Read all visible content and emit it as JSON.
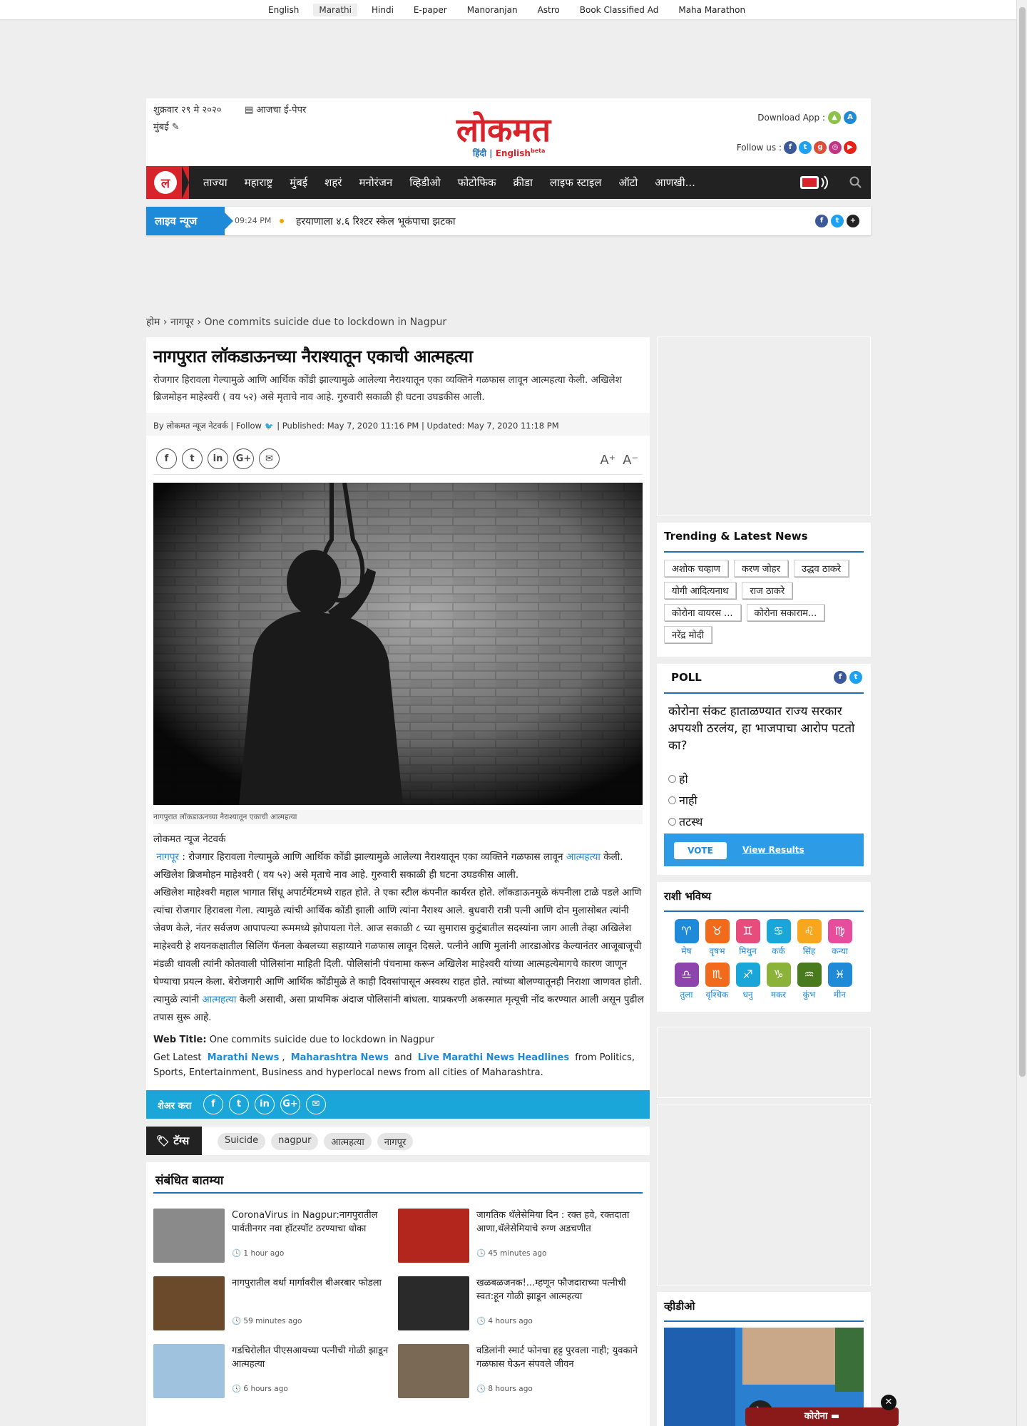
{
  "topbar": {
    "links": [
      {
        "label": "English",
        "active": false
      },
      {
        "label": "Marathi",
        "active": true
      },
      {
        "label": "Hindi",
        "active": false
      },
      {
        "label": "E-paper",
        "active": false
      },
      {
        "label": "Manoranjan",
        "active": false
      },
      {
        "label": "Astro",
        "active": false
      },
      {
        "label": "Book Classified Ad",
        "active": false
      },
      {
        "label": "Maha Marathon",
        "active": false
      }
    ]
  },
  "header": {
    "date": "शुक्रवार २९ मे २०२०",
    "epaper": "आजचा ई-पेपर",
    "city": "मुंबई",
    "logo_text": "लोकमत",
    "logo_hindi": "हिंदी",
    "logo_english": "English",
    "logo_beta": "beta",
    "download_label": "Download App :",
    "follow_label": "Follow us :"
  },
  "nav": {
    "items": [
      "ताज्या",
      "महाराष्ट्र",
      "मुंबई",
      "शहरं",
      "मनोरंजन",
      "व्हिडीओ",
      "फोटोफिक",
      "क्रीडा",
      "लाइफ स्टाइल",
      "ऑटो",
      "आणखी..."
    ]
  },
  "ticker": {
    "label": "लाइव न्यूज",
    "time": "09:24 PM",
    "headline": "हरयाणाला ४.६ रिश्टर स्केल भूकंपाचा झटका"
  },
  "breadcrumb": {
    "home": "होम",
    "section": "नागपूर",
    "current": "One commits suicide due to lockdown in Nagpur"
  },
  "article": {
    "title": "नागपुरात लॉकडाऊनच्या नैराश्यातून एकाची आत्महत्या",
    "summary": "रोजगार हिरावला गेल्यामुळे आणि आर्थिक कोंडी झाल्यामुळे आलेल्या नैराश्यातून एका व्यक्तिने गळफास लावून आत्महत्या केली. अखिलेश ब्रिजमोहन माहेश्वरी ( वय ५२) असे मृताचे नाव आहे. गुरुवारी सकाळी ही घटना उघडकीस आली.",
    "byline_author": "By लोकमत न्यूज नेटवर्क | Follow",
    "byline_dates": "| Published: May 7, 2020 11:16 PM | Updated: May 7, 2020 11:18 PM",
    "caption": "नागपुरात लॉकडाऊनच्या नैराश्यातून एकाची आत्महत्या",
    "network": "लोकमत न्यूज नेटवर्क",
    "p1_link_city": "नागपूर",
    "p1_text_a": " : रोजगार हिरावला गेल्यामुळे आणि आर्थिक कोंडी झाल्यामुळे आलेल्या नैराश्यातून एका व्यक्तिने गळफास लावून ",
    "p1_link_word": "आत्महत्या",
    "p1_text_b": " केली. अखिलेश ब्रिजमोहन माहेश्वरी ( वय ५२) असे मृताचे नाव आहे. गुरुवारी सकाळी ही घटना उघडकीस आली.",
    "p2_text_a": "अखिलेश माहेश्वरी महाल भागात सिंधू अपार्टमेंटमध्ये राहत होते. ते एका स्टील कंपनीत कार्यरत होते. लॉकडाऊनमुळे कंपनीला टाळे पडले आणि त्यांचा रोजगार हिरावला गेला. त्यामुळे त्यांची आर्थिक कोंडी झाली आणि त्यांना नैराश्य आले. बुधवारी रात्री पत्नी आणि दोन मुलासोबत त्यांनी जेवण केले, नंतर सर्वजण आपापल्या रूममध्ये झोपायला गेले. आज सकाळी ८ च्या सुमारास कुटुंबातील सदस्यांना जाग आली तेव्हा अखिलेश माहेश्वरी हे शयनकक्षातील सिलिंग फॅनला केबलच्या सहाय्याने गळफास लावून दिसले. पत्नीने आणि मुलांनी आरडाओरड केल्यानंतर आजूबाजूची मंडळी धावली त्यांनी कोतवाली पोलिसांना माहिती दिली. पोलिसांनी पंचनामा करून अखिलेश माहेश्वरी यांच्या आत्महत्येमागचे कारण जाणून घेण्याचा प्रयत्न केला. बेरोजगारी आणि आर्थिक कोंडीमुळे ते काही दिवसांपासून अस्वस्थ राहत होते. त्यांच्या बोलण्यातूनही निराशा जाणवत होती. त्यामुळे त्यांनी ",
    "p2_link_word": "आत्महत्या",
    "p2_text_b": " केली असावी, असा प्राथमिक अंदाज पोलिसांनी बांधला. याप्रकरणी अकस्मात मृत्यूची नोंद करण्यात आली असून पुढील तपास सुरू आहे.",
    "web_title_label": "Web Title:",
    "web_title": "One commits suicide due to lockdown in Nagpur",
    "get_latest_a": "Get Latest",
    "link_marathi_news": "Marathi News",
    "comma": ",",
    "link_maharashtra_news": "Maharashtra News",
    "and": "and",
    "link_live_headlines": "Live Marathi News Headlines",
    "get_latest_b": "from Politics, Sports, Entertainment, Business and hyperlocal news from all cities of Maharashtra.",
    "share_label": "शेअर करा"
  },
  "tags": {
    "label": "टॅग्स",
    "items": [
      "Suicide",
      "nagpur",
      "आत्महत्या",
      "नागपूर"
    ]
  },
  "related": {
    "heading": "संबंधित बातम्या",
    "items": [
      {
        "title": "CoronaVirus in Nagpur:नागपुरातील पार्वतीनगर नवा हॉटस्पॉट ठरण्याचा धोका",
        "time": "1 hour ago",
        "thumb_color": "#8a8a8a"
      },
      {
        "title": "जागतिक थॅलेसेमिया दिन : रक्त हवे, रक्तदाता आणा,थॅलेसेमियाचे रुग्ण अडचणीत",
        "time": "45 minutes ago",
        "thumb_color": "#b3261e"
      },
      {
        "title": "नागपुरातील वर्धा मार्गावरील बीअरबार फोडला",
        "time": "59 minutes ago",
        "thumb_color": "#6b4a2b"
      },
      {
        "title": "खळबळजनक!...म्हणून फौजदाराच्या पत्नीची स्वत:हून गोळी झाडून आत्महत्या",
        "time": "4 hours ago",
        "thumb_color": "#2a2a2a"
      },
      {
        "title": "गडचिरोलीत पीएसआयच्या पत्नीची गोळी झाडून आत्महत्या",
        "time": "6 hours ago",
        "thumb_color": "#9fc3de"
      },
      {
        "title": "वडिलांनी स्मार्ट फोनचा हट्ट पुरवला नाही; युवकाने गळफास घेऊन संपवले जीवन",
        "time": "8 hours ago",
        "thumb_color": "#7a6a55"
      }
    ]
  },
  "trending": {
    "heading": "Trending & Latest News",
    "items": [
      "अशोक चव्हाण",
      "करण जोहर",
      "उद्धव ठाकरे",
      "योगी आदित्यनाथ",
      "राज ठाकरे",
      "कोरोना वायरस ...",
      "कोरोना सकाराम...",
      "नरेंद्र मोदी"
    ]
  },
  "poll": {
    "heading": "POLL",
    "question": "कोरोना संकट हाताळण्यात राज्य सरकार अपयशी ठरलंय, हा भाजपाचा आरोप पटतो का?",
    "options": [
      "हो",
      "नाही",
      "तटस्थ"
    ],
    "vote_label": "VOTE",
    "view_results": "View Results"
  },
  "rashi": {
    "heading": "राशी भविष्य",
    "signs": [
      {
        "name": "मेष",
        "color": "#1f8ad8",
        "icon": "aries-icon"
      },
      {
        "name": "वृषभ",
        "color": "#f26b1d",
        "icon": "taurus-icon"
      },
      {
        "name": "मिथुन",
        "color": "#e84c7d",
        "icon": "gemini-icon"
      },
      {
        "name": "कर्क",
        "color": "#1aa6d8",
        "icon": "cancer-icon"
      },
      {
        "name": "सिंह",
        "color": "#f7a71e",
        "icon": "leo-icon"
      },
      {
        "name": "कन्या",
        "color": "#e84c9c",
        "icon": "virgo-icon"
      },
      {
        "name": "तुला",
        "color": "#8e44ad",
        "icon": "libra-icon"
      },
      {
        "name": "वृश्चिक",
        "color": "#f26b1d",
        "icon": "scorpio-icon"
      },
      {
        "name": "धनु",
        "color": "#1aa6d8",
        "icon": "sagittarius-icon"
      },
      {
        "name": "मकर",
        "color": "#8bb33a",
        "icon": "capricorn-icon"
      },
      {
        "name": "कुंभ",
        "color": "#4a7a1e",
        "icon": "aquarius-icon"
      },
      {
        "name": "मीन",
        "color": "#1f8ad8",
        "icon": "pisces-icon"
      }
    ]
  },
  "video": {
    "heading": "व्हीडीओ"
  },
  "corona_badge": "कोरोना"
}
